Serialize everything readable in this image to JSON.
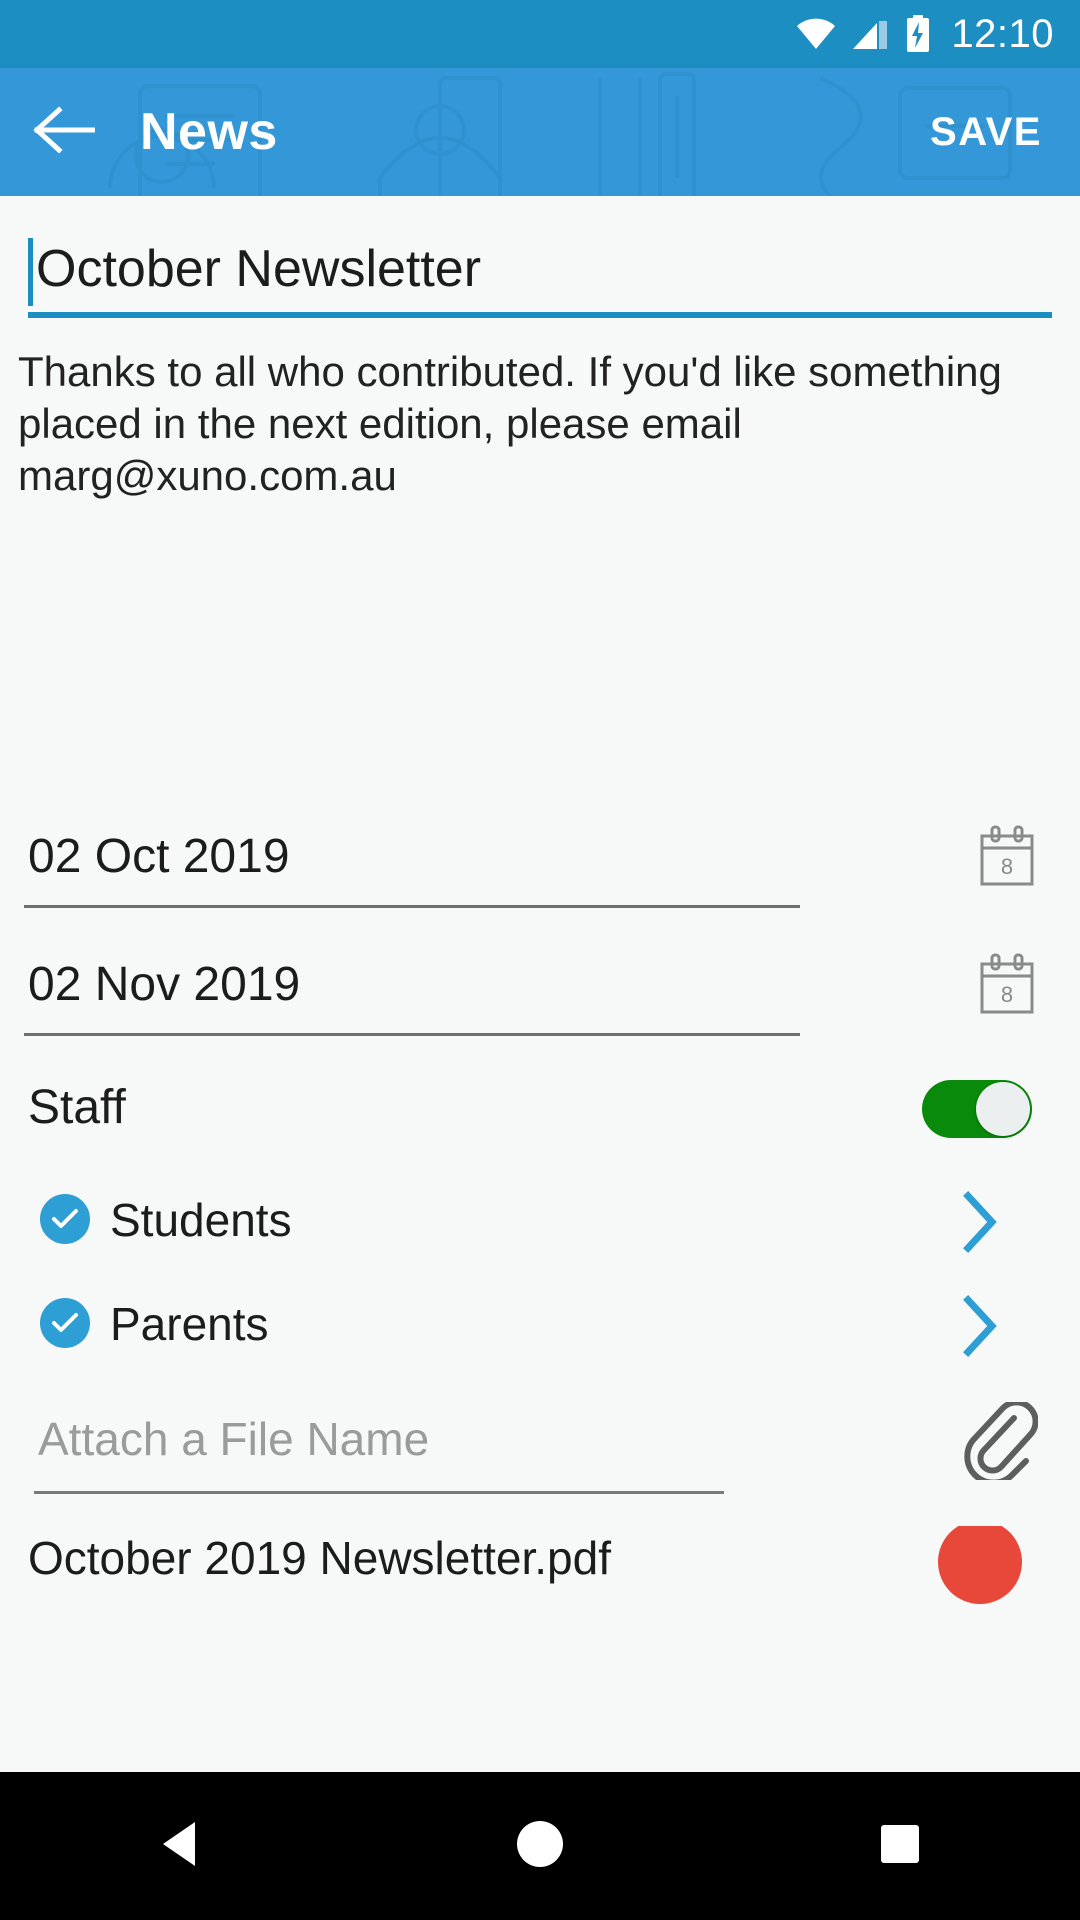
{
  "status_bar": {
    "time": "12:10",
    "icons": [
      "wifi-icon",
      "signal-icon",
      "battery-charging-icon"
    ]
  },
  "app_bar": {
    "back_icon": "arrow-left-icon",
    "title": "News",
    "save_label": "SAVE",
    "background_color": "#3498d8"
  },
  "form": {
    "title_input": {
      "value": "October Newsletter",
      "underline_color": "#1d8ec2"
    },
    "body_input": {
      "value": "Thanks to all who contributed. If you'd like something placed in the next edition, please email marg@xuno.com.au"
    },
    "start_date": {
      "value": "02 Oct 2019",
      "icon": "calendar-icon",
      "icon_day": "8"
    },
    "end_date": {
      "value": "02 Nov 2019",
      "icon": "calendar-icon",
      "icon_day": "8"
    },
    "staff": {
      "label": "Staff",
      "toggle_on": true,
      "toggle_color": "#0a8a0a"
    },
    "audiences": [
      {
        "label": "Students",
        "checked": true,
        "chevron": "chevron-right-icon"
      },
      {
        "label": "Parents",
        "checked": true,
        "chevron": "chevron-right-icon"
      }
    ],
    "attachment_input": {
      "placeholder": "Attach a File Name",
      "value": "",
      "icon": "paperclip-icon"
    },
    "attached_file": {
      "name": "October 2019 Newsletter.pdf",
      "delete_color": "#e8483a"
    }
  },
  "nav_bar": {
    "back": "triangle-back-icon",
    "home": "circle-home-icon",
    "recents": "square-recents-icon"
  }
}
